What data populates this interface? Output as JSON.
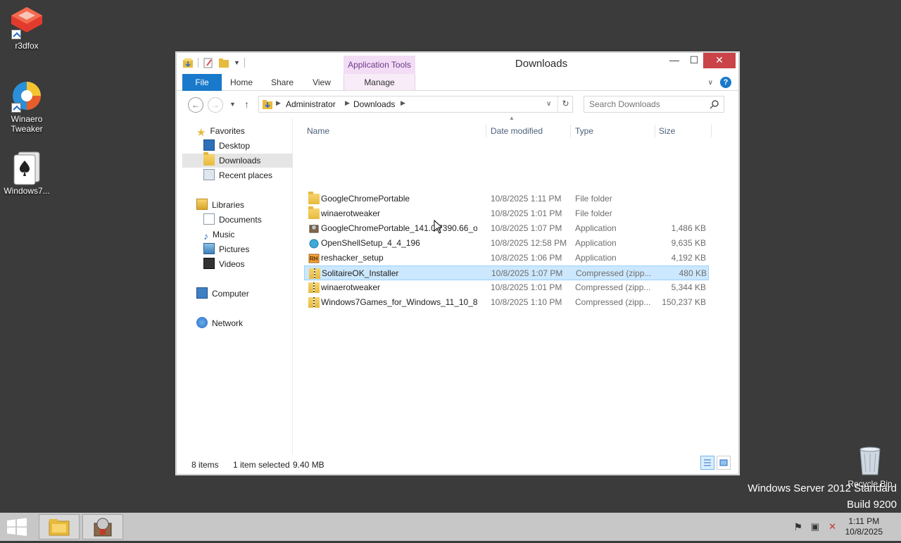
{
  "desktop": {
    "icons": [
      {
        "label": "r3dfox",
        "icon": "r3dfox-icon"
      },
      {
        "label": "Winaero Tweaker",
        "icon": "winaero-tweaker-icon"
      },
      {
        "label": "Windows7...",
        "icon": "solitaire-cards-icon"
      },
      {
        "label": "Recycle Bin",
        "icon": "recycle-bin-icon"
      }
    ],
    "watermark_line1": "Windows Server 2012 Standard",
    "watermark_line2": "Build 9200"
  },
  "window": {
    "title": "Downloads",
    "contextual_tab": "Application Tools",
    "ribbon_tabs": {
      "file": "File",
      "home": "Home",
      "share": "Share",
      "view": "View",
      "manage": "Manage"
    },
    "controls": {
      "minimize": "—",
      "maximize": "☐",
      "close": "✕"
    },
    "help": "?"
  },
  "address": {
    "crumbs": [
      "Administrator",
      "Downloads"
    ],
    "search_placeholder": "Search Downloads"
  },
  "navpane": {
    "favorites": "Favorites",
    "desktop": "Desktop",
    "downloads": "Downloads",
    "recent": "Recent places",
    "libraries": "Libraries",
    "documents": "Documents",
    "music": "Music",
    "pictures": "Pictures",
    "videos": "Videos",
    "computer": "Computer",
    "network": "Network"
  },
  "columns": {
    "name": "Name",
    "date": "Date modified",
    "type": "Type",
    "size": "Size"
  },
  "files": [
    {
      "name": "GoogleChromePortable",
      "date": "10/8/2025 1:11 PM",
      "type": "File folder",
      "size": "",
      "icon": "folder-icon"
    },
    {
      "name": "winaerotweaker",
      "date": "10/8/2025 1:01 PM",
      "type": "File folder",
      "size": "",
      "icon": "folder-icon"
    },
    {
      "name": "GoogleChromePortable_141.0.7390.66_o...",
      "date": "10/8/2025 1:07 PM",
      "type": "Application",
      "size": "1,486 KB",
      "icon": "installer-icon"
    },
    {
      "name": "OpenShellSetup_4_4_196",
      "date": "10/8/2025 12:58 PM",
      "type": "Application",
      "size": "9,635 KB",
      "icon": "shell-icon"
    },
    {
      "name": "reshacker_setup",
      "date": "10/8/2025 1:06 PM",
      "type": "Application",
      "size": "4,192 KB",
      "icon": "reshacker-icon"
    },
    {
      "name": "SolitaireOK_Installer",
      "date": "10/8/2025 1:07 PM",
      "type": "Compressed (zipp...",
      "size": "480 KB",
      "icon": "zip-icon",
      "selected": true
    },
    {
      "name": "winaerotweaker",
      "date": "10/8/2025 1:01 PM",
      "type": "Compressed (zipp...",
      "size": "5,344 KB",
      "icon": "zip-icon"
    },
    {
      "name": "Windows7Games_for_Windows_11_10_8",
      "date": "10/8/2025 1:10 PM",
      "type": "Compressed (zipp...",
      "size": "150,237 KB",
      "icon": "zip-icon"
    }
  ],
  "status": {
    "count": "8 items",
    "selected": "1 item selected",
    "size": "9.40 MB"
  },
  "taskbar": {
    "time": "1:11 PM",
    "date": "10/8/2025"
  },
  "colors": {
    "accent": "#1979ca",
    "selection": "#cce8ff",
    "selection_border": "#99d1ff",
    "close": "#c94348",
    "context_tab": "#f3dcf5"
  }
}
